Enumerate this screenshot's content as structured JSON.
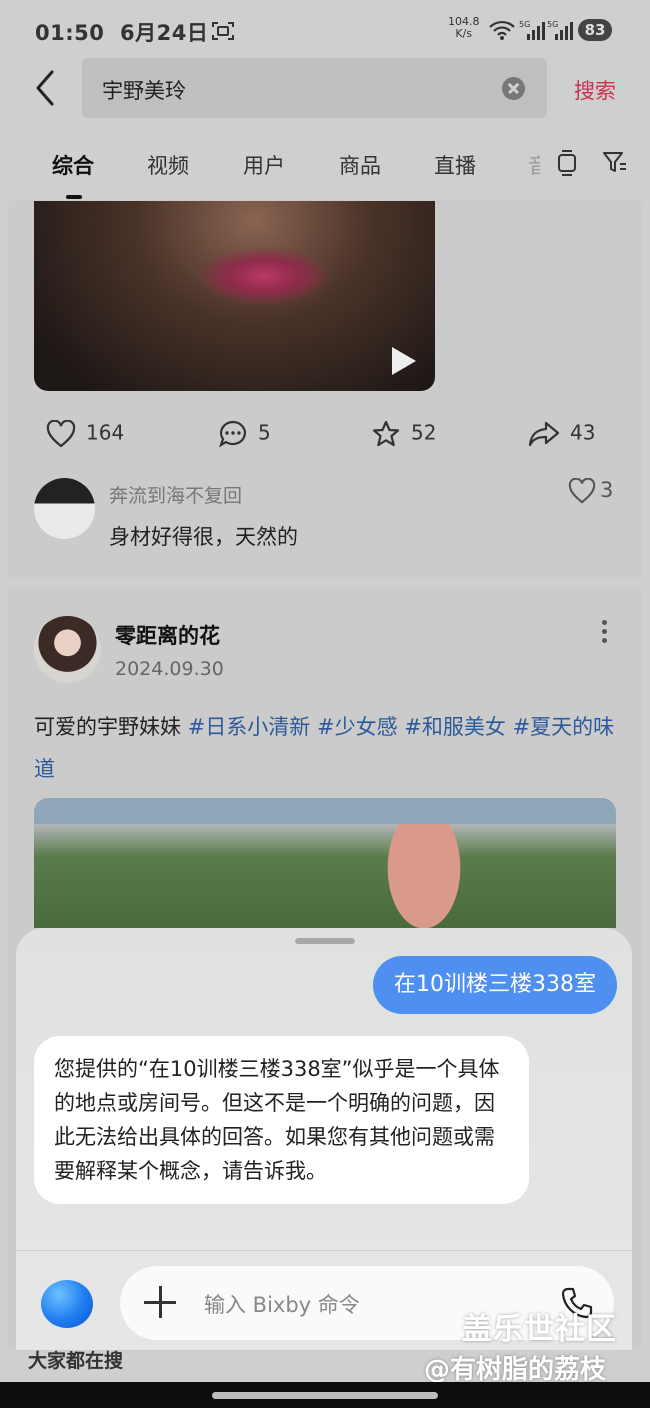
{
  "status_bar": {
    "time": "01:50",
    "date": "6月24日",
    "net_speed_value": "104.8",
    "net_speed_unit": "K/s",
    "battery": "83"
  },
  "search": {
    "query": "宇野美玲",
    "search_button": "搜索"
  },
  "tabs": [
    "综合",
    "视频",
    "用户",
    "商品",
    "直播"
  ],
  "post1": {
    "likes": "164",
    "comments": "5",
    "favorites": "52",
    "shares": "43",
    "comment": {
      "user": "奔流到海不复回",
      "text": "身材好得很，天然的",
      "likes": "3"
    }
  },
  "post2": {
    "author": "零距离的花",
    "date": "2024.09.30",
    "text": "可爱的宇野妹妹 ",
    "tags": [
      "#日系小清新",
      "#少女感",
      "#和服美女",
      "#夏天的味道"
    ]
  },
  "bixby": {
    "user_message": "在10训楼三楼338室",
    "reply": "您提供的“在10训楼三楼338室”似乎是一个具体的地点或房间号。但这不是一个明确的问题，因此无法给出具体的回答。如果您有其他问题或需要解释某个概念，请告诉我。",
    "input_placeholder": "输入 Bixby 命令"
  },
  "behind_text": "大家都在搜",
  "watermark": {
    "line1": "盖乐世社区",
    "line2": "@有树脂的荔枝"
  }
}
